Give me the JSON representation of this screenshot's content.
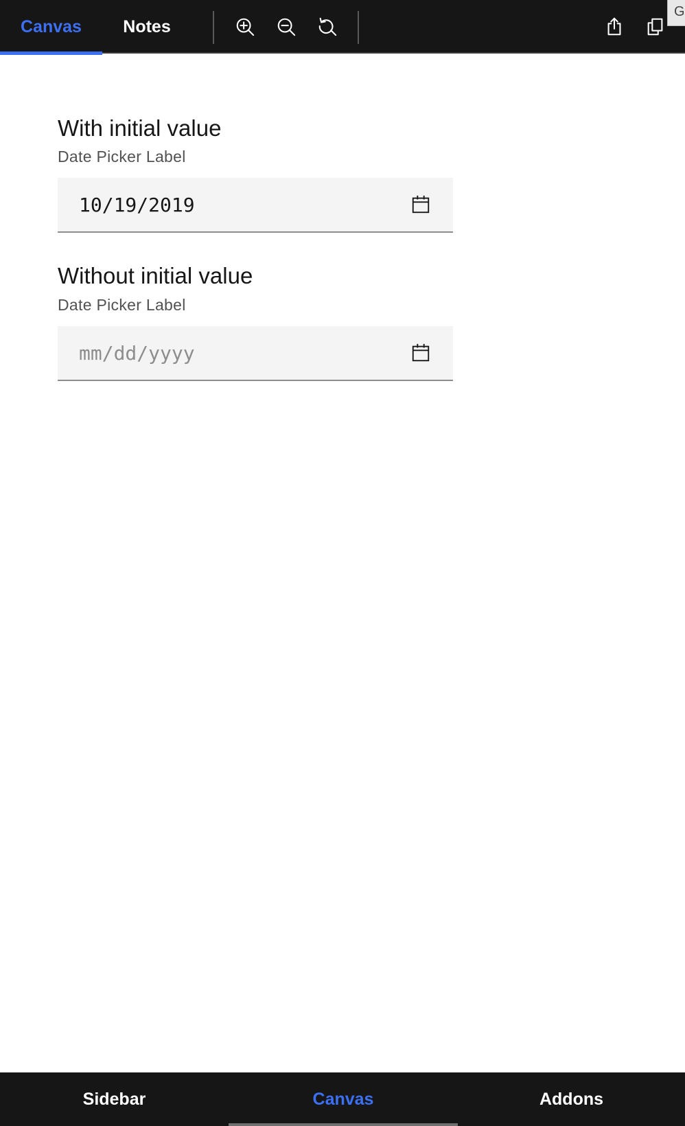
{
  "toolbar": {
    "tabs": [
      {
        "label": "Canvas",
        "active": true
      },
      {
        "label": "Notes",
        "active": false
      }
    ],
    "tools": [
      "zoom-in-icon",
      "zoom-out-icon",
      "reset-zoom-icon"
    ],
    "actions": [
      "share-icon",
      "copy-icon"
    ],
    "corner_tab": "G",
    "accent_color": "#3d6ff2"
  },
  "main": {
    "sections": [
      {
        "title": "With initial value",
        "label": "Date Picker Label",
        "value": "10/19/2019",
        "placeholder": "mm/dd/yyyy"
      },
      {
        "title": "Without initial value",
        "label": "Date Picker Label",
        "value": "",
        "placeholder": "mm/dd/yyyy"
      }
    ]
  },
  "bottom_nav": {
    "items": [
      {
        "label": "Sidebar",
        "active": false
      },
      {
        "label": "Canvas",
        "active": true
      },
      {
        "label": "Addons",
        "active": false
      }
    ]
  }
}
